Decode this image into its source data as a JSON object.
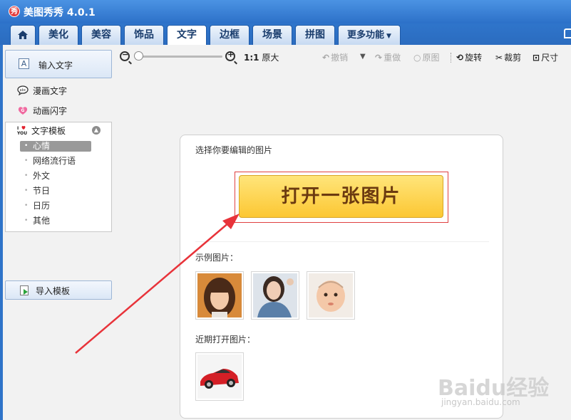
{
  "app": {
    "title": "美图秀秀 4.0.1",
    "logo_char": "秀"
  },
  "tabs": [
    {
      "label": ""
    },
    {
      "label": "美化"
    },
    {
      "label": "美容"
    },
    {
      "label": "饰品"
    },
    {
      "label": "文字"
    },
    {
      "label": "边框"
    },
    {
      "label": "场景"
    },
    {
      "label": "拼图"
    },
    {
      "label": "更多功能"
    }
  ],
  "active_tab": "文字",
  "sidebar": {
    "input_text": "输入文字",
    "comic_text": "漫画文字",
    "anim_text": "动画闪字",
    "template_title": "文字模板",
    "template_items": [
      "心情",
      "网络流行语",
      "外文",
      "节日",
      "日历",
      "其他"
    ],
    "active_template": "心情",
    "import_label": "导入模板"
  },
  "toolbar": {
    "zoom_label_bold": "1:1",
    "zoom_label": "原大",
    "undo": "撤销",
    "redo": "重做",
    "original": "原图",
    "rotate": "旋转",
    "crop": "裁剪",
    "size": "尺寸"
  },
  "panel": {
    "title": "选择你要编辑的图片",
    "open_button": "打开一张图片",
    "sample_label": "示例图片：",
    "recent_label": "近期打开图片："
  },
  "watermark": {
    "text": "Baidu经验",
    "url": "jingyan.baidu.com"
  },
  "colors": {
    "accent": "#2c70c8",
    "button": "#fcc733",
    "highlight_frame": "#e04040",
    "arrow": "#e8333a"
  }
}
